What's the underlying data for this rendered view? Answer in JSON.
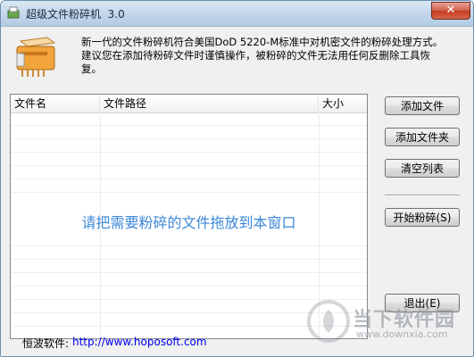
{
  "window": {
    "title": "超级文件粉碎机  3.0",
    "close_label": "✕"
  },
  "description": "新一代的文件粉碎机符合美国DoD 5220-M标准中对机密文件的粉碎处理方式。建议您在添加待粉碎文件时谨慎操作，被粉碎的文件无法用任何反删除工具恢复。",
  "list": {
    "columns": [
      "文件名",
      "文件路径",
      "大小"
    ],
    "drop_hint": "请把需要粉碎的文件拖放到本窗口"
  },
  "buttons": {
    "add_file": "添加文件",
    "add_folder": "添加文件夹",
    "clear_list": "清空列表",
    "start": "开始粉碎(S)",
    "exit": "退出(E)"
  },
  "footer": {
    "label": "恒波软件:",
    "link": "http://www.hoposoft.com"
  },
  "watermark": {
    "brand": "当下软件园",
    "url": "www.downxia.com"
  },
  "colors": {
    "hint_blue": "#3d88d8",
    "link_blue": "#0000ee",
    "close_red": "#c43b22"
  }
}
